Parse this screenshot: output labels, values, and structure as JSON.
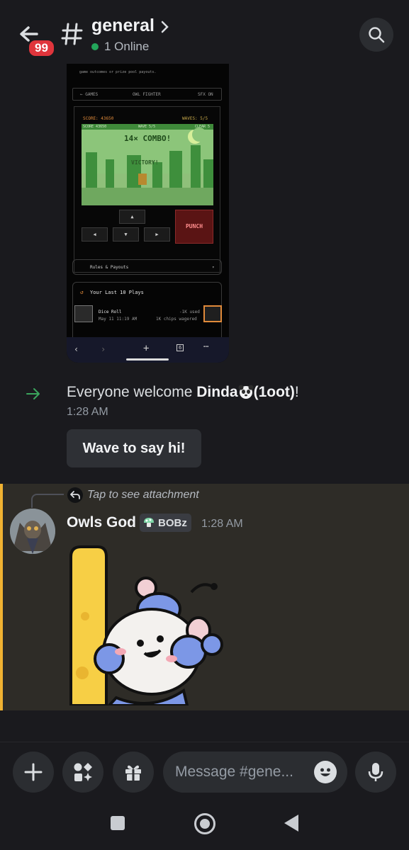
{
  "header": {
    "back_badge": "99",
    "channel_name": "general",
    "online_status": "1 Online"
  },
  "attachment_screenshot": {
    "pool_caption": "game outcomes or prize pool payouts.",
    "nav_back": "← GAMES",
    "game_name": "OWL FIGHTER",
    "sfx": "SFX ON",
    "score": "SCORE: 43650",
    "waves": "WAVES: 5/5",
    "hud_score": "SCORE 43650",
    "hud_wave": "WAVE 5/5",
    "hud_clear": "CLEAR 5",
    "combo": "14× COMBO!",
    "victory": "VICTORY!",
    "punch": "PUNCH",
    "rules": "Rules & Payouts",
    "last_plays": "Your Last 10 Plays",
    "play_game": "Dice Roll",
    "play_time": "May 11 11:19 AM",
    "play_used": "-1K used",
    "play_wagered": "1K chips wagered",
    "tab_count": "6"
  },
  "welcome": {
    "prefix": "Everyone welcome ",
    "name": "Dinda",
    "handle": "(1oot)",
    "suffix": "!",
    "time": "1:28 AM",
    "wave_button": "Wave to say hi!"
  },
  "message": {
    "reply_text": "Tap to see attachment",
    "author": "Owls God",
    "tag": "BOBz",
    "time": "1:28 AM"
  },
  "composer": {
    "placeholder": "Message #gene..."
  },
  "colors": {
    "accent_mention": "#f0b232",
    "online_green": "#23a55a",
    "badge_red": "#e0353c"
  }
}
